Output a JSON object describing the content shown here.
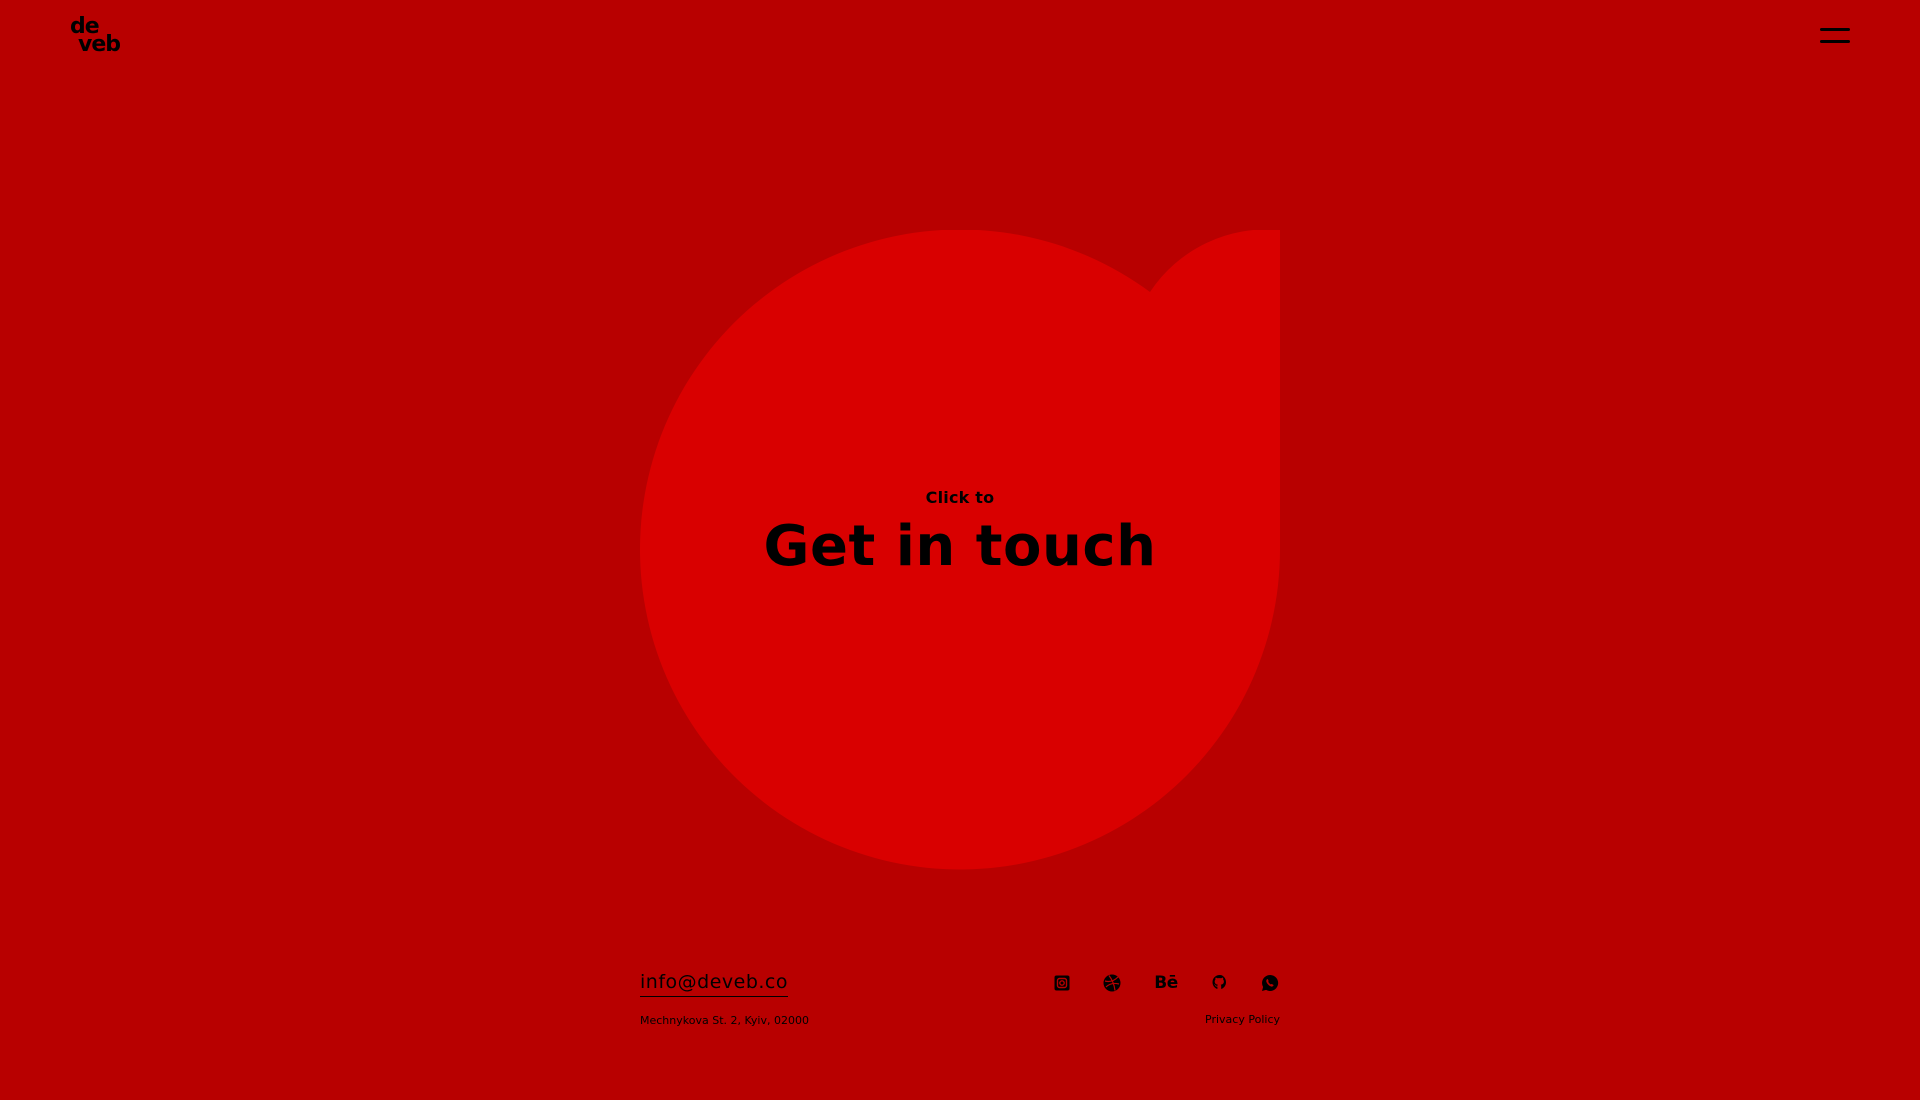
{
  "logo": {
    "line1": "de",
    "line2": "veb"
  },
  "header": {
    "menu_icon": "hamburger-menu-icon"
  },
  "hero": {
    "small_label": "Click to",
    "title": "Get in touch"
  },
  "footer": {
    "email": "info@deveb.co",
    "address": "Mechnykova St. 2, Kyiv, 02000",
    "socials": [
      {
        "icon": "instagram-icon"
      },
      {
        "icon": "dribbble-icon"
      },
      {
        "icon": "behance-icon",
        "label": "Bē"
      },
      {
        "icon": "github-icon"
      },
      {
        "icon": "whatsapp-icon"
      }
    ],
    "privacy": "Privacy Policy"
  },
  "colors": {
    "background": "#b80000",
    "shape": "#d90000",
    "text": "#000000"
  }
}
